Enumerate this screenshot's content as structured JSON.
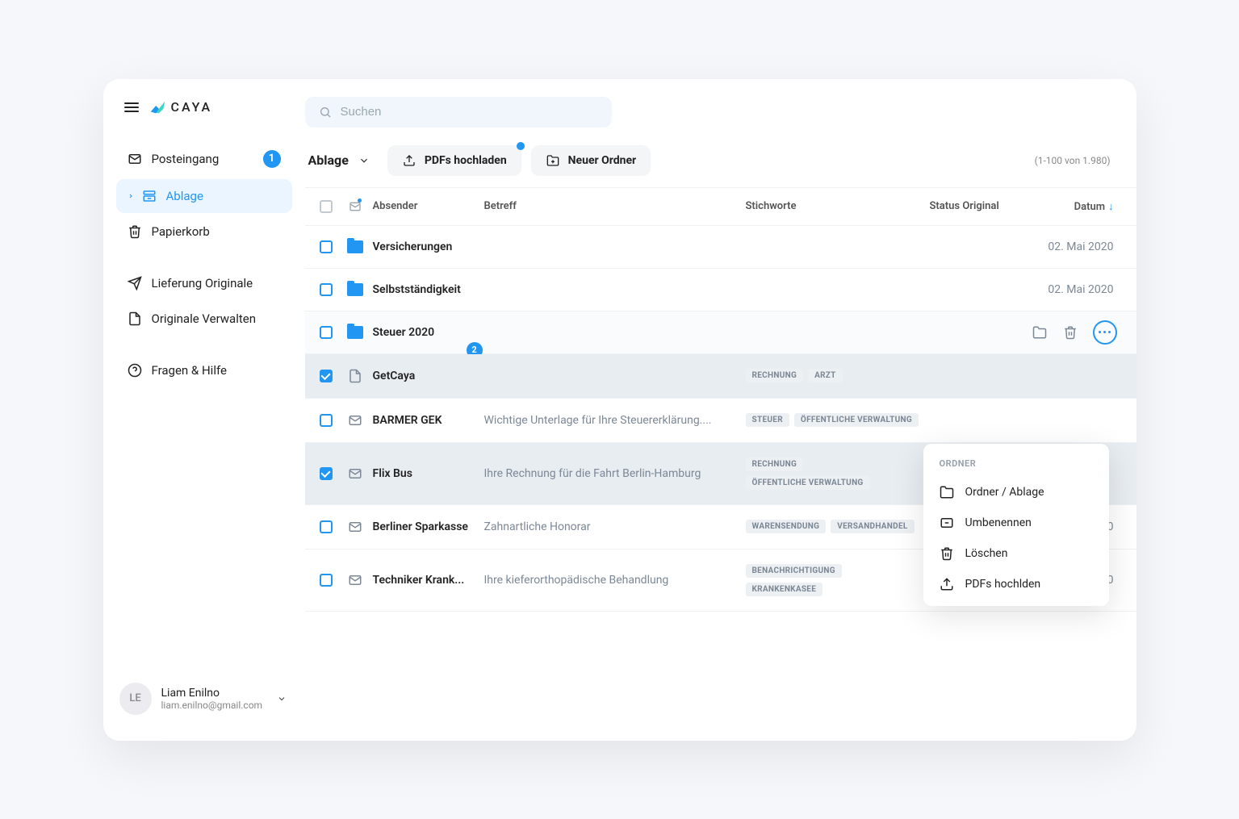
{
  "brand": "CAYA",
  "search": {
    "placeholder": "Suchen"
  },
  "sidebar": {
    "items": [
      {
        "label": "Posteingang",
        "icon": "mail-icon",
        "badge": "1"
      },
      {
        "label": "Ablage",
        "icon": "archive-icon",
        "active": true,
        "chevron": true
      },
      {
        "label": "Papierkorb",
        "icon": "trash-icon"
      },
      {
        "label": "Lieferung Originale",
        "icon": "send-icon",
        "gap_before": true
      },
      {
        "label": "Originale Verwalten",
        "icon": "file-icon"
      },
      {
        "label": "Fragen & Hilfe",
        "icon": "help-icon",
        "gap_before": true
      }
    ]
  },
  "user": {
    "initials": "LE",
    "name": "Liam Enilno",
    "email": "liam.enilno@gmail.com"
  },
  "toolbar": {
    "crumb": "Ablage",
    "upload_label": "PDFs hochladen",
    "new_folder_label": "Neuer Ordner",
    "pager": "(1-100 von 1.980)"
  },
  "columns": {
    "sender": "Absender",
    "subject": "Betreff",
    "tags": "Stichworte",
    "status": "Status Original",
    "date": "Datum"
  },
  "rows": [
    {
      "type": "folder",
      "sender": "Versicherungen",
      "subject": "",
      "tags": [],
      "date": "02. Mai 2020"
    },
    {
      "type": "folder",
      "sender": "Selbstständigkeit",
      "subject": "",
      "tags": [],
      "date": "02. Mai 2020"
    },
    {
      "type": "folder",
      "sender": "Steuer 2020",
      "subject": "",
      "tags": [],
      "date": "",
      "hovered": true,
      "show_actions": true,
      "count_badge": "2"
    },
    {
      "type": "file",
      "checked": true,
      "sender": "GetCaya",
      "subject": "",
      "tags": [
        "RECHNUNG",
        "ARZT"
      ],
      "date": ""
    },
    {
      "type": "mail",
      "sender": "BARMER GEK",
      "subject": "Wichtige Unterlage für Ihre Steuererklärung....",
      "tags": [
        "STEUER",
        "ÖFFENTLICHE VERWALTUNG"
      ],
      "date": ""
    },
    {
      "type": "mail",
      "checked": true,
      "sender": "Flix Bus",
      "subject": "Ihre Rechnung für die Fahrt Berlin-Hamburg",
      "tags": [
        "RECHNUNG",
        "ÖFFENTLICHE VERWALTUNG"
      ],
      "date": ""
    },
    {
      "type": "mail",
      "sender": "Berliner Sparkasse",
      "subject": "Zahnartliche Honorar",
      "tags": [
        "WARENSENDUNG",
        "VERSANDHANDEL"
      ],
      "date": "02. Mai 2020",
      "status_icon": "send"
    },
    {
      "type": "mail",
      "sender": "Techniker Krank...",
      "subject": "Ihre kieferorthopädische Behandlung",
      "tags": [
        "BENACHRICHTIGUNG",
        "KRANKENKASEE"
      ],
      "date": "02. Mai 2020",
      "status_icon": "home"
    }
  ],
  "context_menu": {
    "title": "ORDNER",
    "items": [
      {
        "label": "Ordner / Ablage",
        "icon": "folder-outline-icon"
      },
      {
        "label": "Umbenennen",
        "icon": "rename-icon"
      },
      {
        "label": "Löschen",
        "icon": "trash-icon"
      },
      {
        "label": "PDFs hochlden",
        "icon": "upload-icon"
      }
    ]
  }
}
